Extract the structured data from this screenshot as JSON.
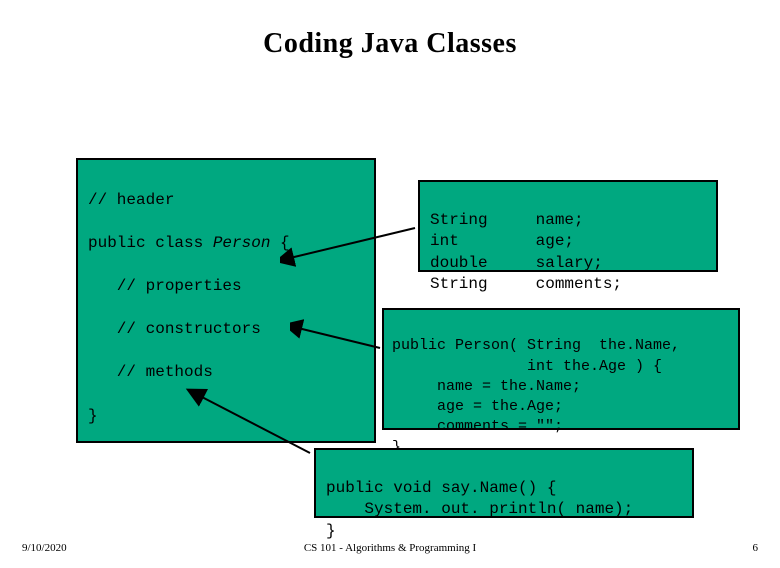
{
  "title": "Coding Java Classes",
  "main_box": {
    "l1": "// header",
    "l2": "public class ",
    "l2_italic": "Person",
    "l2_end": " {",
    "l3": "   // properties",
    "l4": "   // constructors",
    "l5": "   // methods",
    "l6": "}"
  },
  "props_box": {
    "l1": "String     name;",
    "l2": "int        age;",
    "l3": "double     salary;",
    "l4": "String     comments;"
  },
  "constr_box": {
    "l1": "public Person( String  the.Name,",
    "l2": "               int the.Age ) {",
    "l3": "     name = the.Name;",
    "l4": "     age = the.Age;",
    "l5": "     comments = \"\";",
    "l6": "}"
  },
  "method_box": {
    "l1": "public void say.Name() {",
    "l2": "    System. out. println( name);",
    "l3": "}"
  },
  "footer": {
    "date": "9/10/2020",
    "course": "CS 101 - Algorithms & Programming I",
    "page": "6"
  }
}
